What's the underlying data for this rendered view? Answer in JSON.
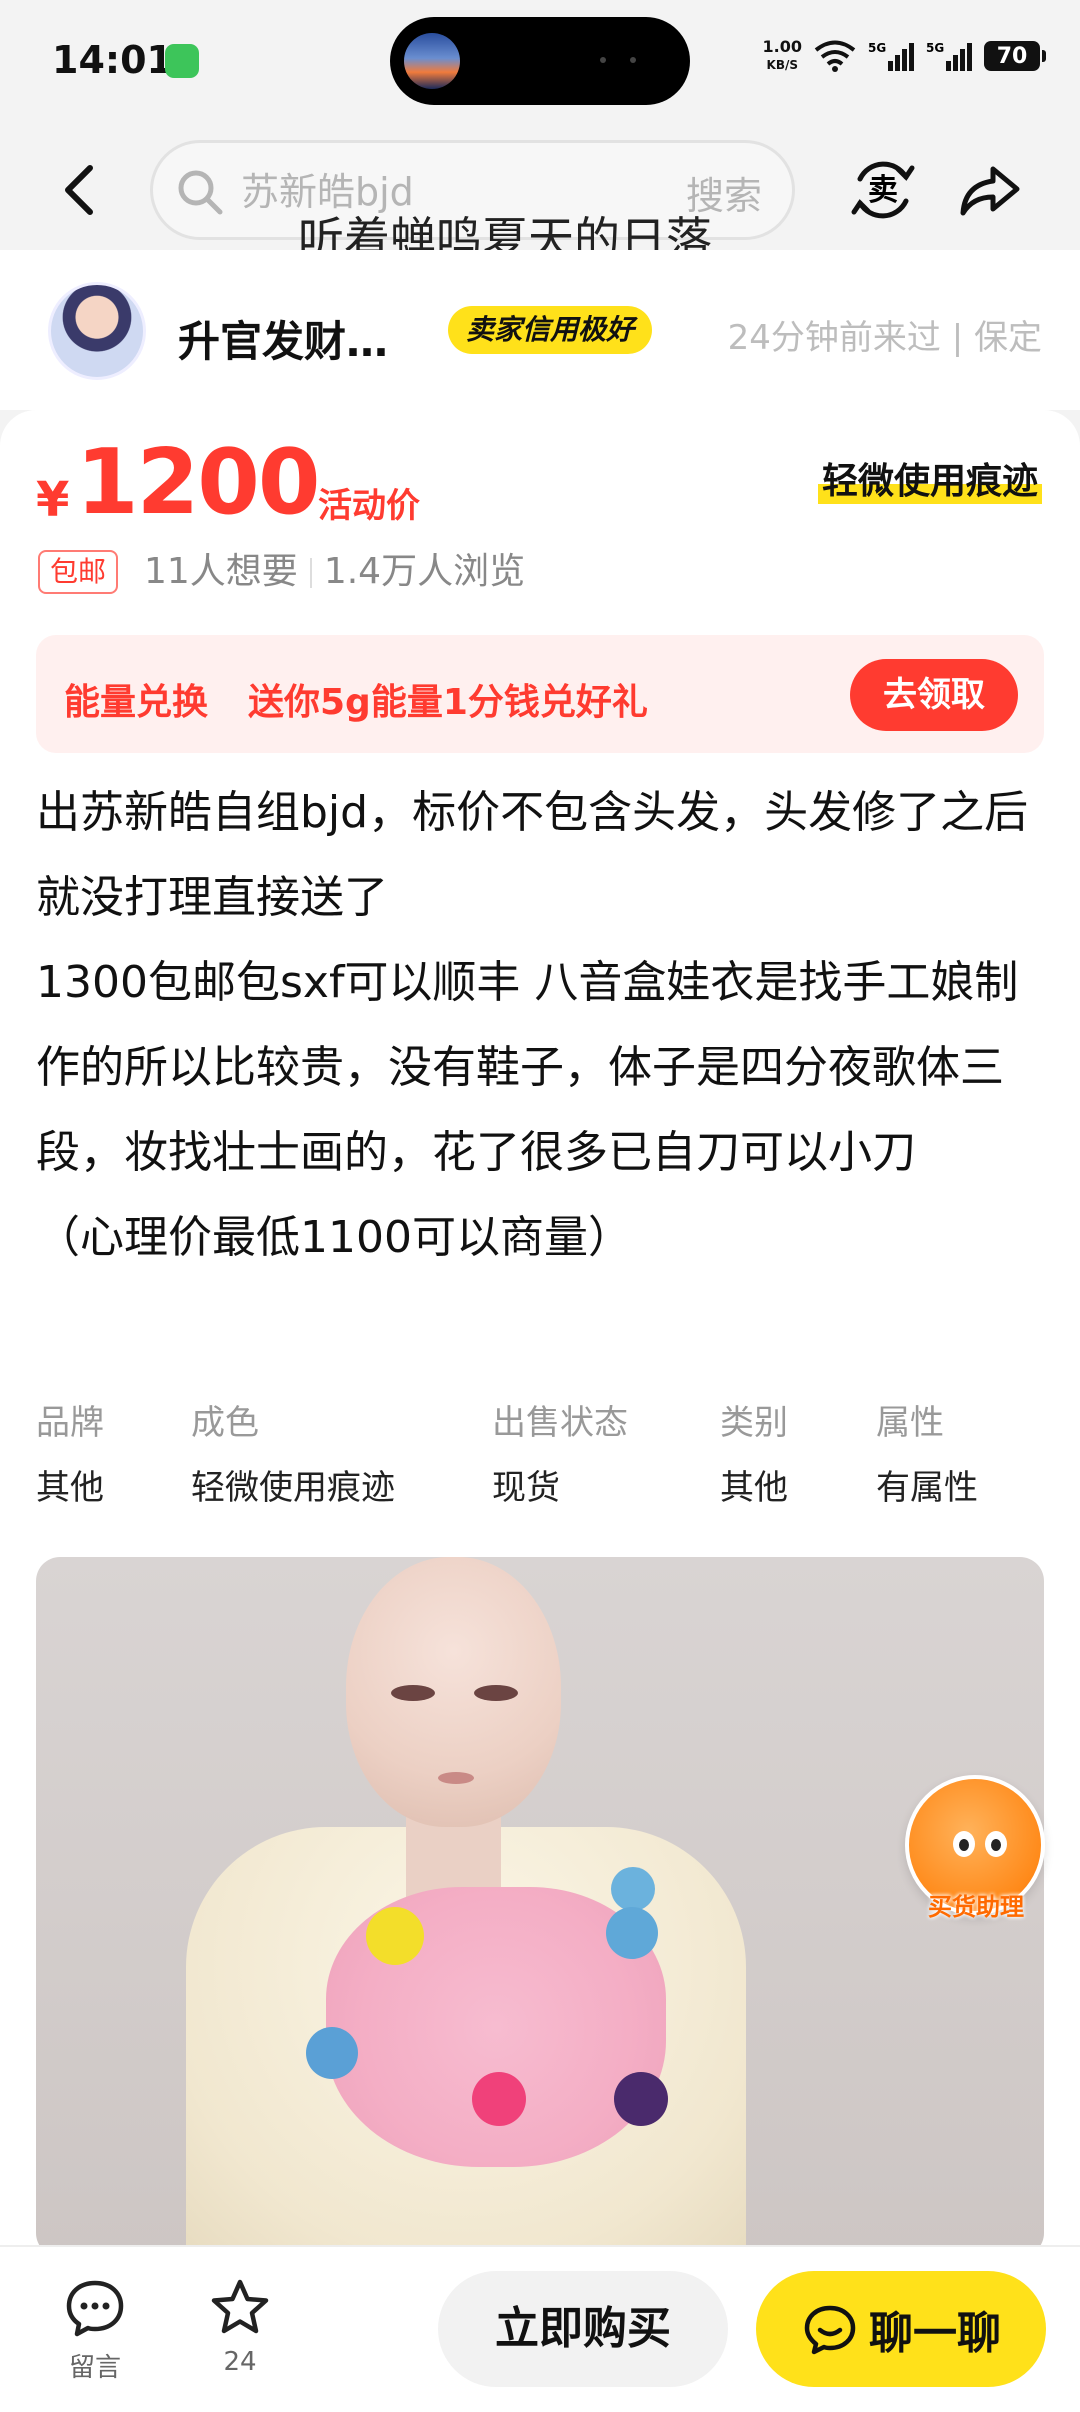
{
  "status_bar": {
    "time": "14:01",
    "net_speed_value": "1.00",
    "net_speed_unit": "KB/S",
    "battery": "70"
  },
  "header": {
    "search_placeholder": "苏新皓bjd",
    "search_button": "搜索",
    "overlay_text": "听着蝉鸣夏天的日落",
    "sell_icon_label": "卖"
  },
  "seller": {
    "name": "升官发财…",
    "credit_badge": "卖家信用极好",
    "meta": "24分钟前来过 | 保定"
  },
  "product": {
    "currency": "¥",
    "price": "1200",
    "price_tag": "活动价",
    "condition": "轻微使用痕迹",
    "shipping_badge": "包邮",
    "wants": "11人想要",
    "views": "1.4万人浏览",
    "energy": {
      "title": "能量兑换",
      "desc": "送你5g能量1分钱兑好礼",
      "button": "去领取"
    },
    "description": "出苏新皓自组bjd，标价不包含头发，头发修了之后就没打理直接送了\n1300包邮包sxf可以顺丰 八音盒娃衣是找手工娘制作的所以比较贵，没有鞋子，体子是四分夜歌体三段，妆找壮士画的，花了很多已自刀可以小刀\n（心理价最低1100可以商量）",
    "attributes": [
      {
        "key": "品牌",
        "value": "其他"
      },
      {
        "key": "成色",
        "value": "轻微使用痕迹"
      },
      {
        "key": "出售状态",
        "value": "现货"
      },
      {
        "key": "类别",
        "value": "其他"
      },
      {
        "key": "属性",
        "value": "有属性"
      }
    ]
  },
  "assistant_fab": {
    "label": "买货助理"
  },
  "bottom_bar": {
    "comment_label": "留言",
    "favorite_count": "24",
    "buy_now": "立即购买",
    "chat": "聊一聊"
  },
  "colors": {
    "accent_yellow": "#ffe11a",
    "price_red": "#ff3b30"
  }
}
